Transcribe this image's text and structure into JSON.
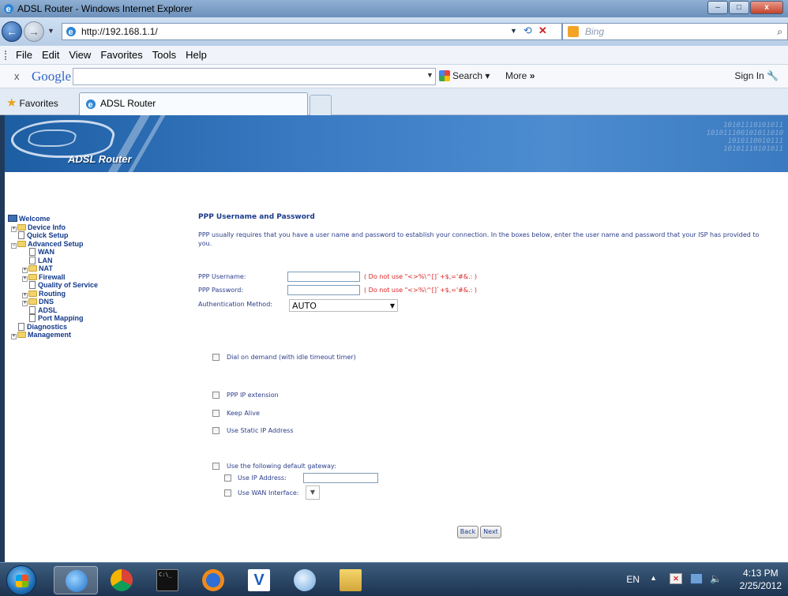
{
  "window": {
    "title": "ADSL Router - Windows Internet Explorer",
    "buttons": [
      "–",
      "□",
      "x"
    ]
  },
  "address_bar": {
    "url": "http://192.168.1.1/",
    "search_placeholder": "Bing"
  },
  "menu": [
    "File",
    "Edit",
    "View",
    "Favorites",
    "Tools",
    "Help"
  ],
  "google_toolbar": {
    "close": "x",
    "logo": "Google",
    "search_label": "Search",
    "more_label": "More",
    "more_arrows": "»",
    "sign_in": "Sign In"
  },
  "favorites_bar": {
    "favorites": "Favorites",
    "tab_title": "ADSL Router"
  },
  "banner": {
    "brand": "ADSL Router",
    "binary": "10101110101011\n101011100101011010\n1010110010111\n10101110101011"
  },
  "sidebar": [
    {
      "label": "Welcome",
      "icon": "pc-icon",
      "level": 0,
      "toggle": ""
    },
    {
      "label": "Device Info",
      "icon": "folder-icon",
      "level": 1,
      "toggle": "+"
    },
    {
      "label": "Quick Setup",
      "icon": "page-icon",
      "level": 1,
      "toggle": ""
    },
    {
      "label": "Advanced Setup",
      "icon": "folder-icon",
      "level": 1,
      "toggle": "−"
    },
    {
      "label": "WAN",
      "icon": "page-icon",
      "level": 2,
      "toggle": ""
    },
    {
      "label": "LAN",
      "icon": "page-icon",
      "level": 2,
      "toggle": ""
    },
    {
      "label": "NAT",
      "icon": "folder-icon",
      "level": 2,
      "toggle": "+"
    },
    {
      "label": "Firewall",
      "icon": "folder-icon",
      "level": 2,
      "toggle": "+"
    },
    {
      "label": "Quality of Service",
      "icon": "page-icon",
      "level": 2,
      "toggle": ""
    },
    {
      "label": "Routing",
      "icon": "folder-icon",
      "level": 2,
      "toggle": "+"
    },
    {
      "label": "DNS",
      "icon": "folder-icon",
      "level": 2,
      "toggle": "+"
    },
    {
      "label": "ADSL",
      "icon": "page-icon",
      "level": 2,
      "toggle": ""
    },
    {
      "label": "Port Mapping",
      "icon": "page-icon",
      "level": 2,
      "toggle": ""
    },
    {
      "label": "Diagnostics",
      "icon": "page-icon",
      "level": 1,
      "toggle": ""
    },
    {
      "label": "Management",
      "icon": "folder-icon",
      "level": 1,
      "toggle": "+"
    }
  ],
  "main": {
    "title": "PPP Username and Password",
    "description": "PPP usually requires that you have a user name and password to establish your connection. In the boxes below, enter the user name and password that your ISP has provided to you.",
    "username_label": "PPP Username:",
    "username_value": "",
    "username_note": "( Do not use \"<>%\\^[]`+$,='#&.: )",
    "password_label": "PPP Password:",
    "password_value": "",
    "password_note": "( Do not use \"<>%\\^[]`+$,='#&.: )",
    "auth_label": "Authentication Method:",
    "auth_value": "AUTO",
    "dial_on_demand": "Dial on demand (with idle timeout timer)",
    "ppp_ip_extension": "PPP IP extension",
    "keep_alive": "Keep Alive",
    "use_static_ip": "Use Static IP Address",
    "default_gateway": "Use the following default gateway:",
    "use_ip_address": "Use IP Address:",
    "use_wan_interface": "Use WAN Interface:",
    "back": "Back",
    "next": "Next"
  },
  "taskbar": {
    "lang": "EN",
    "time": "4:13 PM",
    "date": "2/25/2012",
    "cmd_text": "C:\\_"
  },
  "colors": {
    "banner": "#3a7bc4",
    "note": "#dd2222",
    "link": "#123a8c"
  }
}
